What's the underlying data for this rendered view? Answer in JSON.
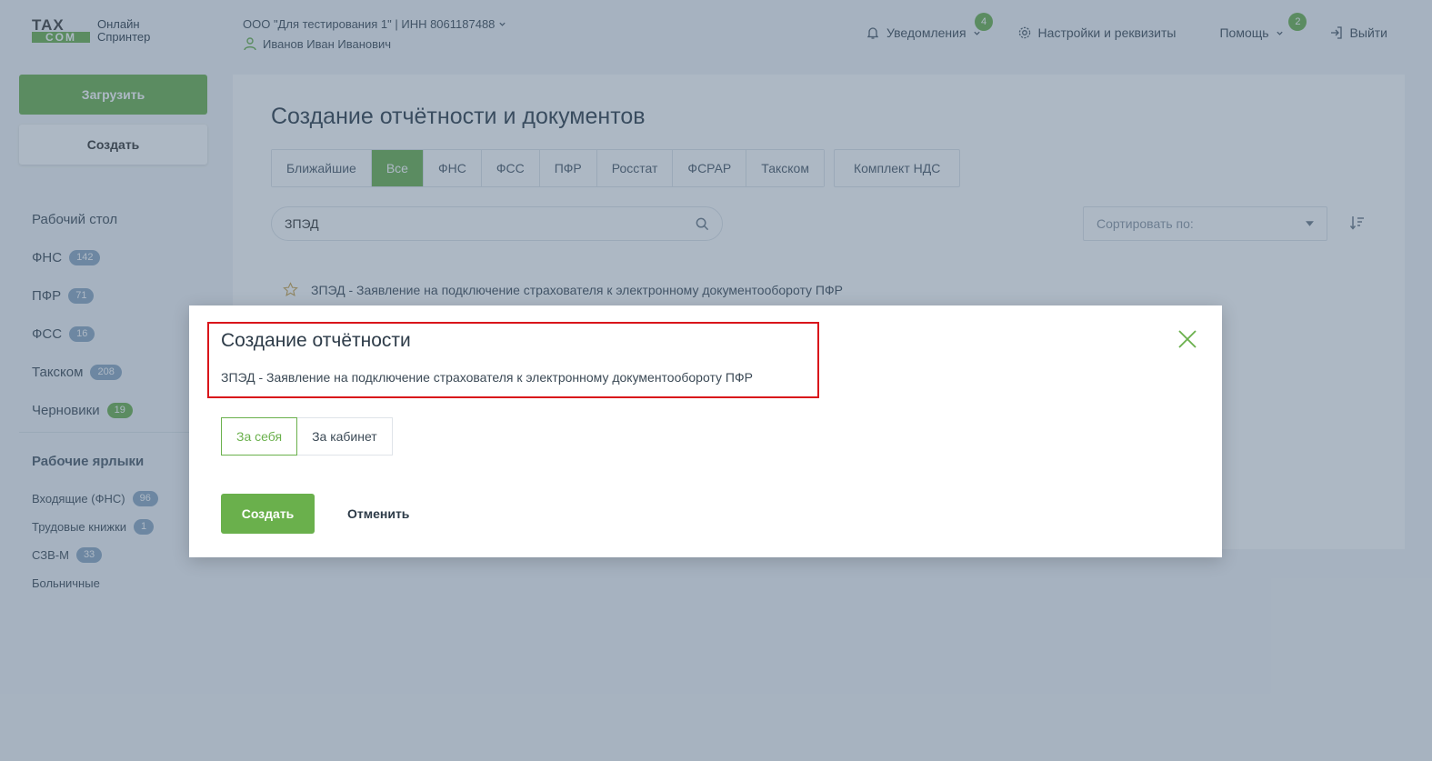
{
  "header": {
    "logo_top": "TAX",
    "logo_bottom": "COM",
    "logo_line1": "Онлайн",
    "logo_line2": "Спринтер",
    "org_line": "ООО \"Для тестирования 1\" | ИНН 8061187488",
    "user_name": "Иванов Иван Иванович",
    "notifications_label": "Уведомления",
    "notifications_count": "4",
    "settings_label": "Настройки и реквизиты",
    "help_label": "Помощь",
    "help_count": "2",
    "logout_label": "Выйти"
  },
  "sidebar": {
    "upload_label": "Загрузить",
    "create_label": "Создать",
    "menu": [
      {
        "label": "Рабочий стол",
        "count": null
      },
      {
        "label": "ФНС",
        "count": "142"
      },
      {
        "label": "ПФР",
        "count": "71"
      },
      {
        "label": "ФСС",
        "count": "16"
      },
      {
        "label": "Такском",
        "count": "208"
      },
      {
        "label": "Черновики",
        "count": "19"
      }
    ],
    "labels_title": "Рабочие ярлыки",
    "labels": [
      {
        "label": "Входящие (ФНС)",
        "count": "96"
      },
      {
        "label": "Трудовые книжки",
        "count": "1"
      },
      {
        "label": "СЗВ-М",
        "count": "33"
      },
      {
        "label": "Больничные",
        "count": null
      }
    ]
  },
  "main": {
    "title": "Создание отчётности и документов",
    "tabs": [
      "Ближайшие",
      "Все",
      "ФНС",
      "ФСС",
      "ПФР",
      "Росстат",
      "ФСРАР",
      "Такском"
    ],
    "active_tab": 1,
    "extra_tab": "Комплект НДС",
    "search_value": "ЗПЭД",
    "sort_placeholder": "Сортировать по:",
    "result": "ЗПЭД - Заявление на подключение страхователя к электронному документообороту ПФР"
  },
  "modal": {
    "title": "Создание отчётности",
    "subtitle": "ЗПЭД - Заявление на подключение страхователя к электронному документообороту ПФР",
    "option_self": "За себя",
    "option_cabinet": "За кабинет",
    "create_label": "Создать",
    "cancel_label": "Отменить"
  },
  "colors": {
    "accent": "#6ab04c",
    "badge_blue": "#8aa6c1",
    "highlight": "#d9151b",
    "overlay": "#4a627c"
  }
}
